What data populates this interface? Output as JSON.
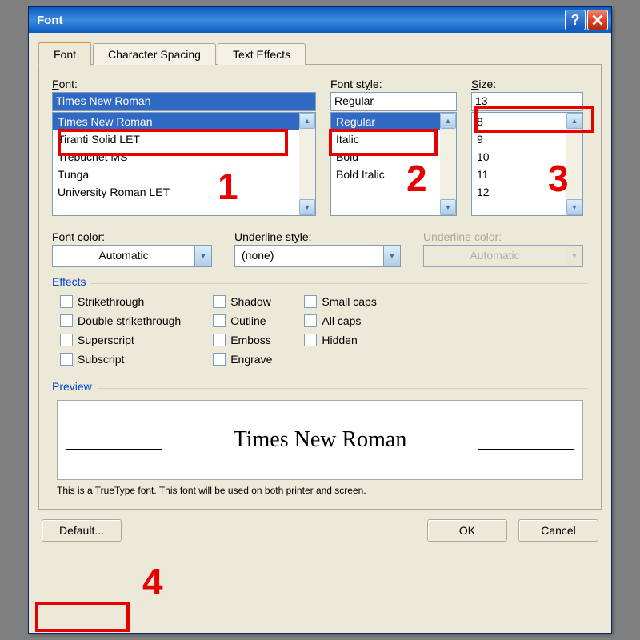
{
  "title": "Font",
  "tabs": {
    "font": "Font",
    "spacing": "Character Spacing",
    "effects": "Text Effects"
  },
  "labels": {
    "font": "Font:",
    "style": "Font style:",
    "size": "Size:",
    "fontcolor": "Font color:",
    "underlinestyle": "Underline style:",
    "underlinecolor": "Underline color:"
  },
  "font": {
    "value": "Times New Roman",
    "items": [
      "Times New Roman",
      "Tiranti Solid LET",
      "Trebuchet MS",
      "Tunga",
      "University Roman LET"
    ]
  },
  "style": {
    "value": "Regular",
    "items": [
      "Regular",
      "Italic",
      "Bold",
      "Bold Italic"
    ]
  },
  "size": {
    "value": "13",
    "items": [
      "8",
      "9",
      "10",
      "11",
      "12"
    ]
  },
  "fontcolor": "Automatic",
  "underlinestyle": "(none)",
  "underlinecolor": "Automatic",
  "effects_title": "Effects",
  "effects": {
    "strike": "Strikethrough",
    "dstrike": "Double strikethrough",
    "super": "Superscript",
    "sub": "Subscript",
    "shadow": "Shadow",
    "outline": "Outline",
    "emboss": "Emboss",
    "engrave": "Engrave",
    "smallcaps": "Small caps",
    "allcaps": "All caps",
    "hidden": "Hidden"
  },
  "preview_title": "Preview",
  "preview_text": "Times New Roman",
  "hint": "This is a TrueType font. This font will be used on both printer and screen.",
  "buttons": {
    "default": "Default...",
    "ok": "OK",
    "cancel": "Cancel"
  },
  "annotations": {
    "a1": "1",
    "a2": "2",
    "a3": "3",
    "a4": "4"
  }
}
